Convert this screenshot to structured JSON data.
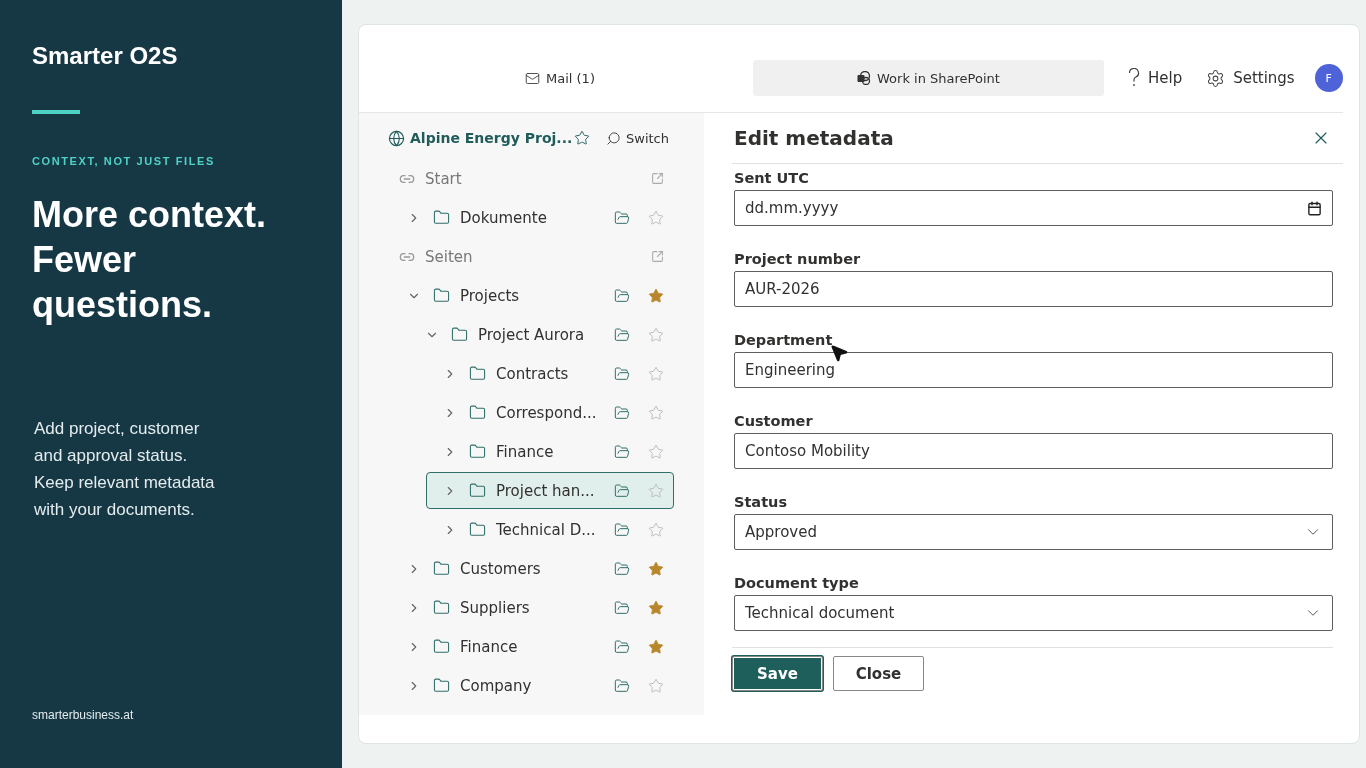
{
  "promo": {
    "brand": "Smarter O2S",
    "eyebrow": "CONTEXT, NOT JUST FILES",
    "headline": "More context. Fewer questions.",
    "body": "Add project, customer and approval status. Keep relevant metadata with your documents.",
    "footer": "smarterbusiness.at"
  },
  "topbar": {
    "mail": "Mail (1)",
    "work": "Work in SharePoint",
    "help": "Help",
    "settings": "Settings",
    "avatar": "F"
  },
  "sidebar": {
    "site": "Alpine Energy Proj...",
    "switch": "Switch",
    "items": [
      {
        "kind": "link",
        "label": "Start"
      },
      {
        "kind": "folder",
        "label": "Dokumente",
        "expanded": false,
        "starred": false,
        "selected": false
      },
      {
        "kind": "link",
        "label": "Seiten"
      },
      {
        "kind": "folder",
        "label": "Projects",
        "expanded": true,
        "starred": true,
        "selected": false,
        "children": [
          {
            "kind": "folder",
            "label": "Project Aurora",
            "expanded": true,
            "starred": false,
            "selected": false,
            "children": [
              {
                "kind": "folder",
                "label": "Contracts",
                "expanded": false,
                "starred": false,
                "selected": false
              },
              {
                "kind": "folder",
                "label": "Correspond...",
                "expanded": false,
                "starred": false,
                "selected": false
              },
              {
                "kind": "folder",
                "label": "Finance",
                "expanded": false,
                "starred": false,
                "selected": false
              },
              {
                "kind": "folder",
                "label": "Project han...",
                "expanded": false,
                "starred": false,
                "selected": true
              },
              {
                "kind": "folder",
                "label": "Technical D...",
                "expanded": false,
                "starred": false,
                "selected": false
              }
            ]
          }
        ]
      },
      {
        "kind": "folder",
        "label": "Customers",
        "expanded": false,
        "starred": true,
        "selected": false
      },
      {
        "kind": "folder",
        "label": "Suppliers",
        "expanded": false,
        "starred": true,
        "selected": false
      },
      {
        "kind": "folder",
        "label": "Finance",
        "expanded": false,
        "starred": true,
        "selected": false
      },
      {
        "kind": "folder",
        "label": "Company",
        "expanded": false,
        "starred": false,
        "selected": false
      }
    ]
  },
  "form": {
    "title": "Edit metadata",
    "fields": [
      {
        "kind": "date",
        "label": "Sent UTC",
        "placeholder": "dd.mm.yyyy"
      },
      {
        "kind": "text",
        "label": "Project number",
        "value": "AUR-2026"
      },
      {
        "kind": "text",
        "label": "Department",
        "value": "Engineering"
      },
      {
        "kind": "text",
        "label": "Customer",
        "value": "Contoso Mobility"
      },
      {
        "kind": "select",
        "label": "Status",
        "value": "Approved"
      },
      {
        "kind": "select",
        "label": "Document type",
        "value": "Technical document"
      }
    ],
    "buttons": [
      {
        "kind": "primary",
        "label": "Save"
      },
      {
        "kind": "secondary",
        "label": "Close"
      }
    ]
  }
}
